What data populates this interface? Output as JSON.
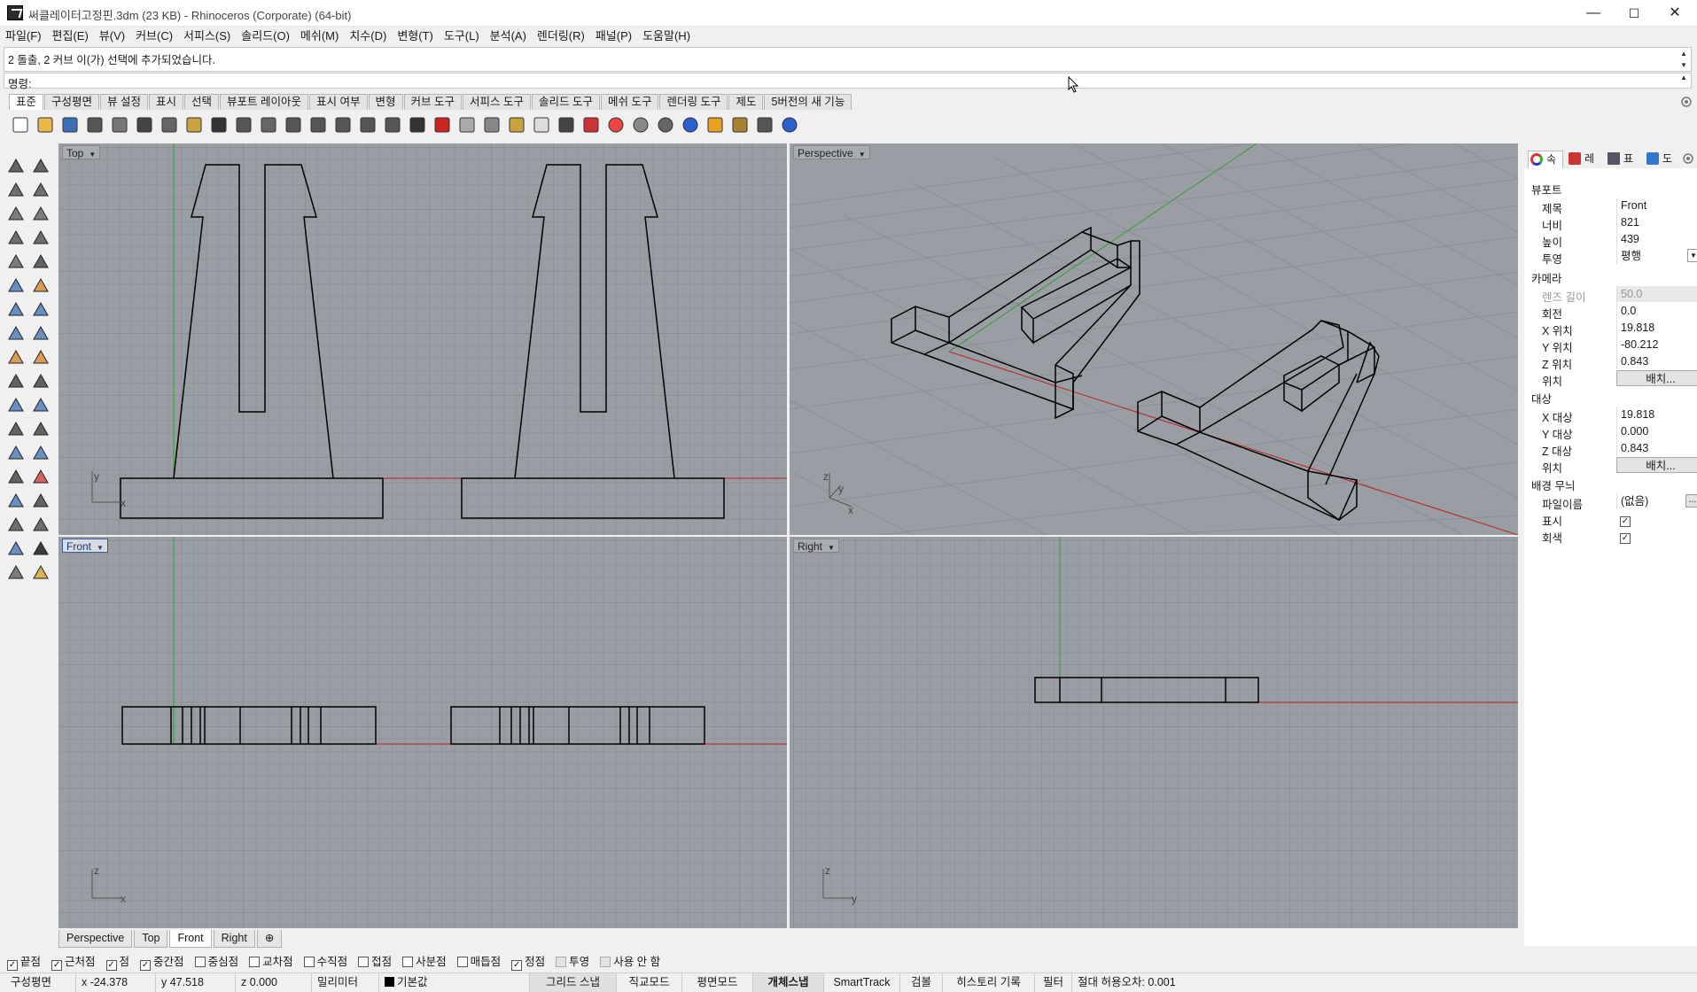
{
  "window": {
    "title": "써클레이터고정핀.3dm (23 KB) - Rhinoceros (Corporate) (64-bit)",
    "controls": [
      "—",
      "☐",
      "✕"
    ]
  },
  "menu": [
    "파일(F)",
    "편집(E)",
    "뷰(V)",
    "커브(C)",
    "서피스(S)",
    "솔리드(O)",
    "메쉬(M)",
    "치수(D)",
    "변형(T)",
    "도구(L)",
    "분석(A)",
    "렌더링(R)",
    "패널(P)",
    "도움말(H)"
  ],
  "command": {
    "history": "2 돌출, 2 커브 이(가) 선택에 추가되었습니다.",
    "prompt": "명령:"
  },
  "toolbar_tabs": [
    "표준",
    "구성평면",
    "뷰 설정",
    "표시",
    "선택",
    "뷰포트 레이아웃",
    "표시 여부",
    "변형",
    "커브 도구",
    "서피스 도구",
    "솔리드 도구",
    "메쉬 도구",
    "렌더링 도구",
    "제도",
    "5버전의 새 기능"
  ],
  "toolbar_icons": [
    "new-file-icon",
    "open-file-icon",
    "save-icon",
    "print-icon",
    "import-icon",
    "cut-icon",
    "copy-icon",
    "paste-icon",
    "undo-icon",
    "pan-hand-icon",
    "rotate-view-icon",
    "zoom-icon",
    "zoom-window-icon",
    "zoom-extents-icon",
    "zoom-selected-icon",
    "rotate-camera-icon",
    "four-viewports-icon",
    "car-render-icon",
    "ghosted-car-icon",
    "gumball-icon",
    "osnap-grid-icon",
    "lightbulb-icon",
    "lock-icon",
    "layer-icon",
    "color-wheel-icon",
    "shaded-sphere-icon",
    "rendered-sphere-icon",
    "blue-sphere-icon",
    "select-filter-icon",
    "options-gear-icon",
    "dimension-icon",
    "help-icon"
  ],
  "viewports": {
    "top": {
      "label": "Top"
    },
    "perspective": {
      "label": "Perspective"
    },
    "front": {
      "label": "Front"
    },
    "right": {
      "label": "Right"
    }
  },
  "axes": {
    "x": "x",
    "y": "y",
    "z": "z"
  },
  "viewport_tabs": [
    "Perspective",
    "Top",
    "Front",
    "Right",
    "⊕"
  ],
  "osnaps": [
    {
      "label": "끝점",
      "checked": true
    },
    {
      "label": "근처점",
      "checked": true
    },
    {
      "label": "점",
      "checked": true
    },
    {
      "label": "중간점",
      "checked": true
    },
    {
      "label": "중심점",
      "checked": false
    },
    {
      "label": "교차점",
      "checked": false
    },
    {
      "label": "수직점",
      "checked": false
    },
    {
      "label": "접점",
      "checked": false
    },
    {
      "label": "사분점",
      "checked": false
    },
    {
      "label": "매듭점",
      "checked": false
    },
    {
      "label": "정점",
      "checked": true
    },
    {
      "label": "투영",
      "checked": false
    },
    {
      "label": "사용 안 함",
      "checked": false
    }
  ],
  "status": {
    "cplane": "구성평면",
    "x": "x -24.378",
    "y": "y 47.518",
    "z": "z 0.000",
    "units": "밀리미터",
    "layer": "기본값",
    "grid_snap": "그리드 스냅",
    "ortho": "직교모드",
    "planar": "평면모드",
    "osnap": "개체스냅",
    "smarttrack": "SmartTrack",
    "gumball": "검볼",
    "history": "히스토리 기록",
    "filter": "필터",
    "tolerance": "절대 허용오차: 0.001"
  },
  "panel": {
    "tabs": [
      "속",
      "레",
      "표",
      "도"
    ],
    "viewport_section": "뷰포트",
    "title_label": "제목",
    "title_value": "Front",
    "width_label": "너비",
    "width_value": "821",
    "height_label": "높이",
    "height_value": "439",
    "projection_label": "투영",
    "projection_value": "평행",
    "camera_section": "카메라",
    "lens_label": "렌즈 길이",
    "lens_value": "50.0",
    "rotation_label": "회전",
    "rotation_value": "0.0",
    "xpos_label": "X 위치",
    "xpos_value": "19.818",
    "ypos_label": "Y 위치",
    "ypos_value": "-80.212",
    "zpos_label": "Z 위치",
    "zpos_value": "0.843",
    "loc_label": "위치",
    "place_button": "배치...",
    "target_section": "대상",
    "xt_label": "X 대상",
    "xt_value": "19.818",
    "yt_label": "Y 대상",
    "yt_value": "0.000",
    "zt_label": "Z 대상",
    "zt_value": "0.843",
    "loc2_label": "위치",
    "place_button2": "배치...",
    "wallpaper_section": "배경 무늬",
    "filename_label": "파일이름",
    "filename_value": "(없음)",
    "browse_button": "...",
    "show_label": "표시",
    "show_checked": true,
    "gray_label": "회색",
    "gray_checked": true
  }
}
